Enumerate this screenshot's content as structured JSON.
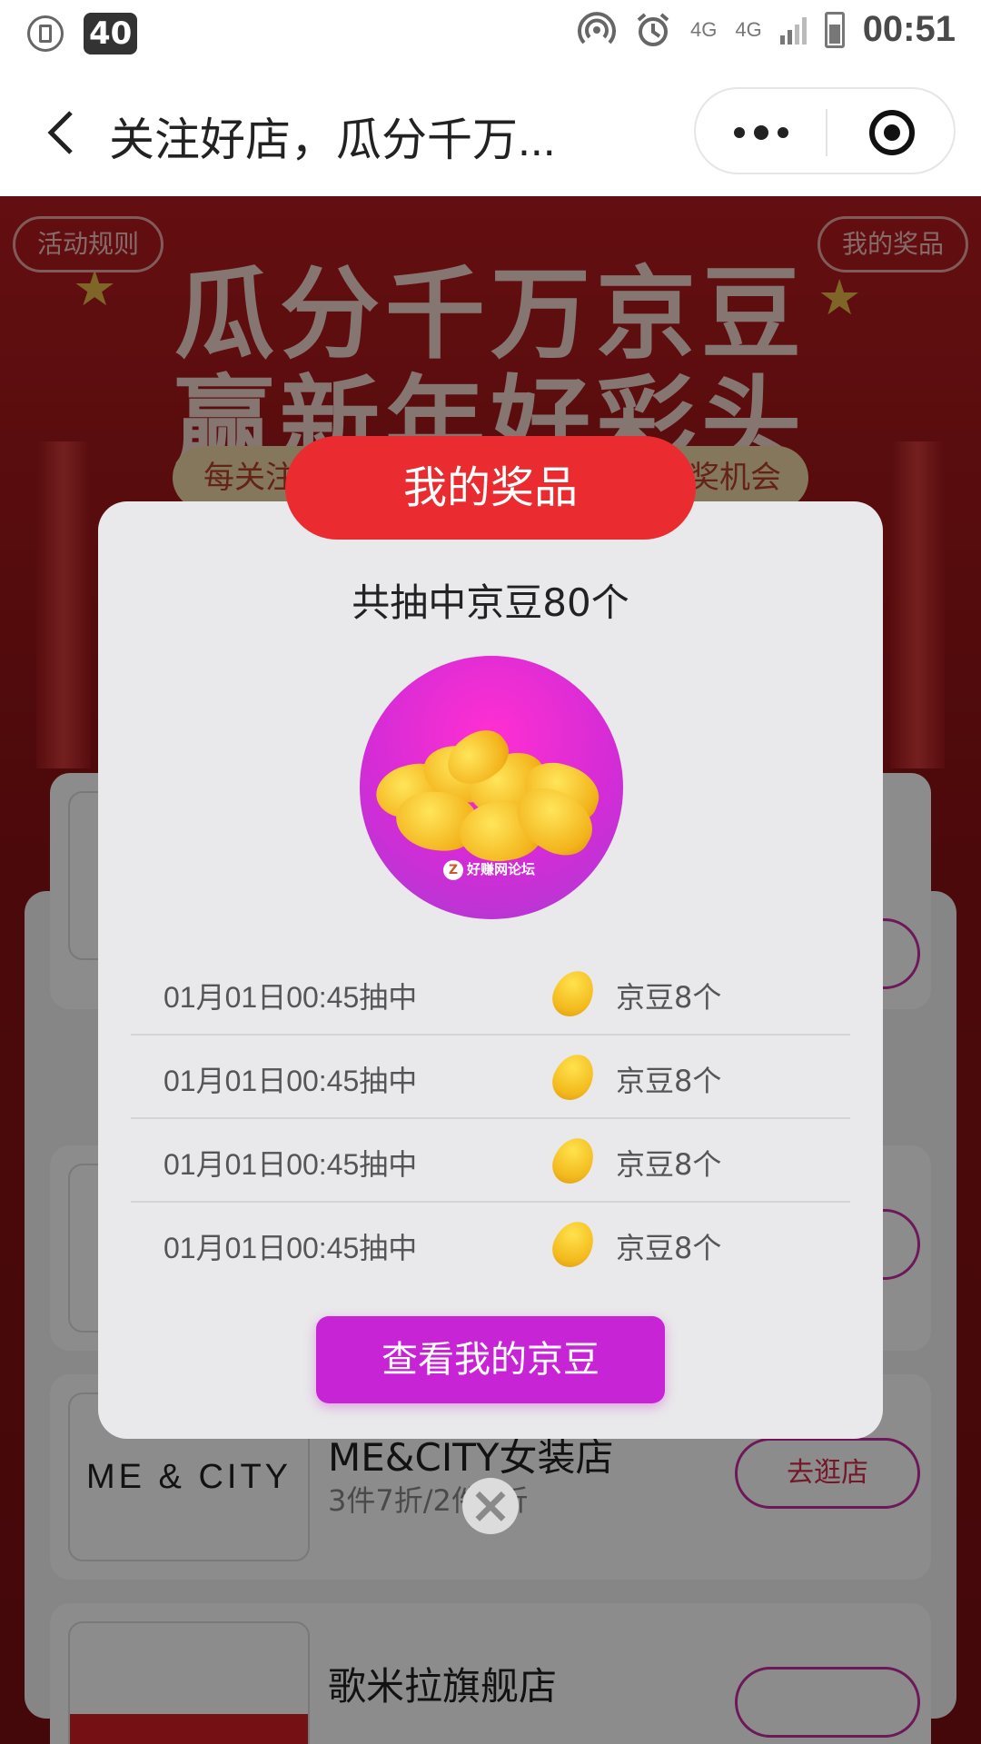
{
  "status_bar": {
    "badge": "40",
    "net_label": "4G",
    "net_label2": "4G",
    "time": "00:51"
  },
  "nav": {
    "title": "关注好店，瓜分千万..."
  },
  "page": {
    "rules_button": "活动规则",
    "my_prizes_button": "我的奖品",
    "hero_line1": "瓜分千万京豆",
    "hero_line2": "赢新年好彩头",
    "ribbon_left": "每关注",
    "ribbon_right": "奖机会",
    "stores": [
      {
        "logo": "",
        "name": "",
        "desc": "",
        "action": ""
      },
      {
        "logo": "",
        "name": "",
        "desc": "",
        "action": ""
      },
      {
        "logo": "ME & CITY",
        "name": "ME&CITY女装店",
        "desc": "3件7折/2件8折",
        "action": "去逛店"
      },
      {
        "logo": "",
        "name": "歌米拉旗舰店",
        "desc": "",
        "action": ""
      }
    ]
  },
  "modal": {
    "header": "我的奖品",
    "total": "共抽中京豆80个",
    "watermark": "好赚网论坛",
    "records": [
      {
        "time": "01月01日00:45抽中",
        "prize": "京豆8个"
      },
      {
        "time": "01月01日00:45抽中",
        "prize": "京豆8个"
      },
      {
        "time": "01月01日00:45抽中",
        "prize": "京豆8个"
      },
      {
        "time": "01月01日00:45抽中",
        "prize": "京豆8个"
      }
    ],
    "view_button": "查看我的京豆"
  },
  "icons": {
    "back": "chevron-left-icon",
    "more": "more-dots-icon",
    "close_miniprogram": "target-circle-icon",
    "close_modal": "close-icon",
    "bean": "jd-bean-icon"
  },
  "colors": {
    "modal_header": "#ea2b30",
    "view_button": "#c624d4",
    "page_bg": "#a01a1c"
  }
}
